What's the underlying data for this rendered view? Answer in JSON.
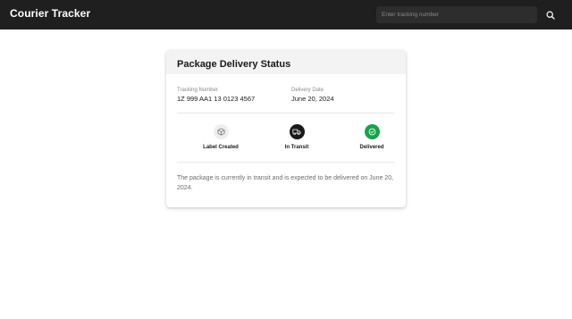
{
  "header": {
    "brand": "Courier Tracker",
    "search_placeholder": "Enter tracking number",
    "search_icon": "search-icon"
  },
  "card": {
    "title": "Package Delivery Status",
    "tracking": {
      "label": "Tracking Number",
      "value": "1Z 999 AA1 13 0123 4567"
    },
    "delivery": {
      "label": "Delivery Date",
      "value": "June 20, 2024"
    },
    "steps": [
      {
        "label": "Label Created",
        "icon": "box-icon",
        "state": "pending"
      },
      {
        "label": "In Transit",
        "icon": "truck-icon",
        "state": "active"
      },
      {
        "label": "Delivered",
        "icon": "check-circle-icon",
        "state": "done"
      }
    ],
    "status_message": "The package is currently in transit and is expected to be delivered on June 20, 2024."
  },
  "colors": {
    "topbar": "#1f1f1f",
    "active_step": "#1a1a1a",
    "delivered_step": "#16a34a",
    "pending_step": "#eeeeee"
  }
}
